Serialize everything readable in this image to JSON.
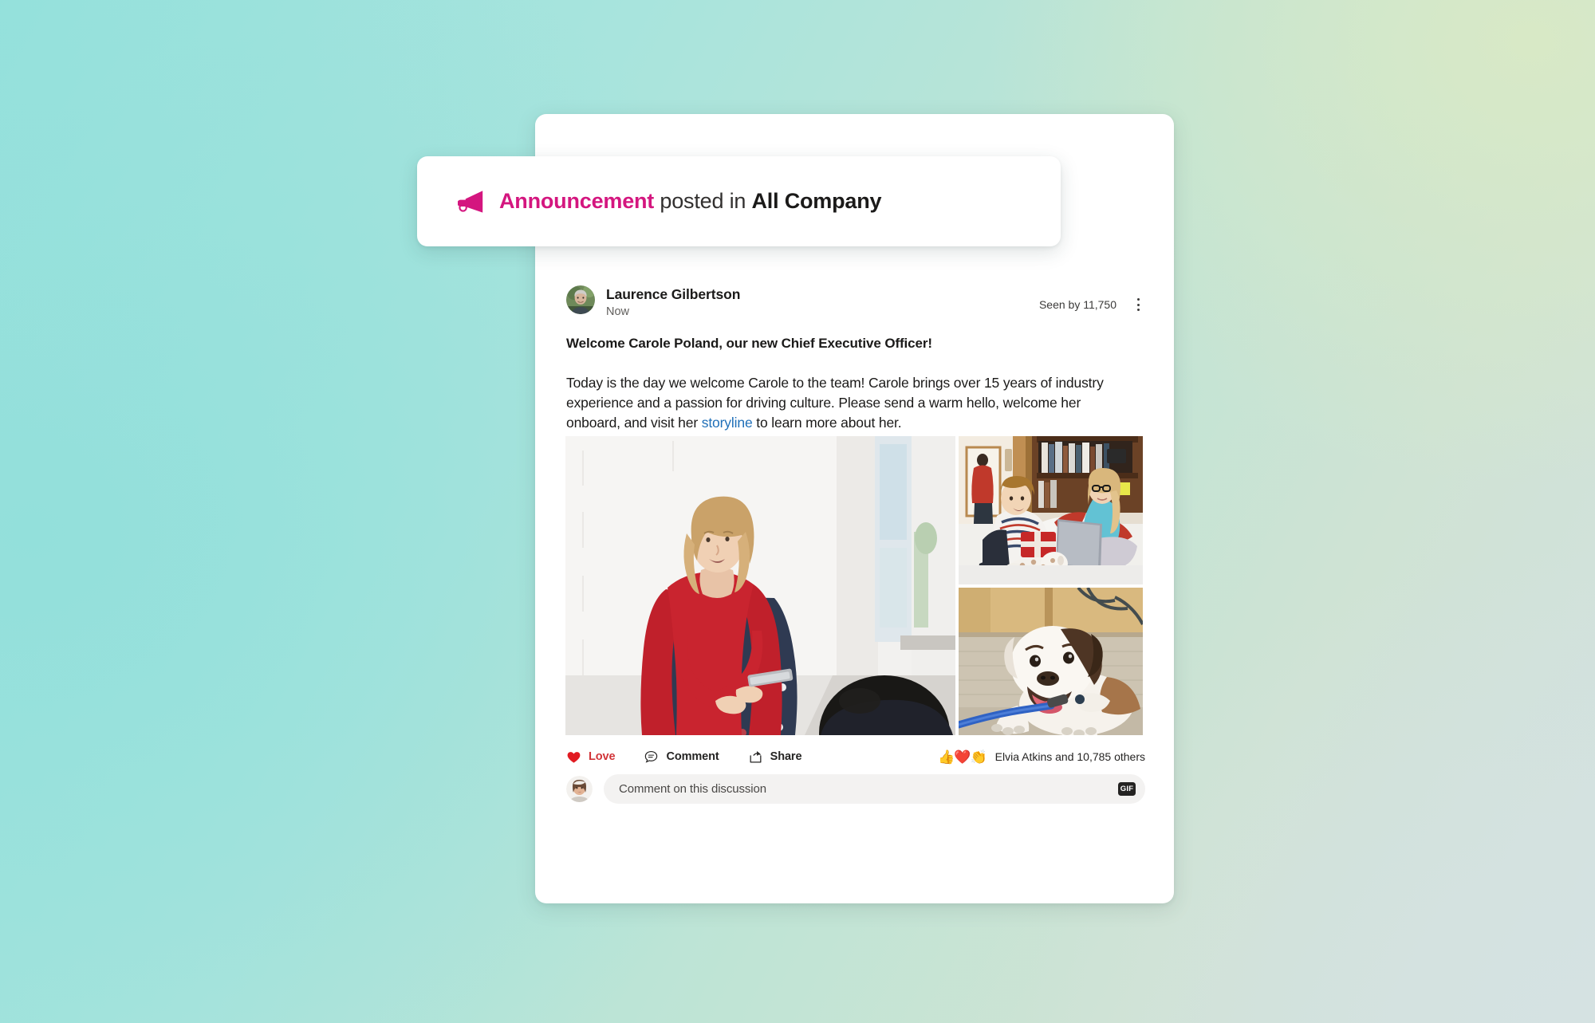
{
  "banner": {
    "icon": "megaphone-icon",
    "keyword": "Announcement",
    "middle": " posted in ",
    "group": "All Company",
    "accent_color": "#d4167f"
  },
  "post": {
    "author": "Laurence Gilbertson",
    "timestamp": "Now",
    "seen_by": "Seen by 11,750",
    "more_menu": "more-options",
    "title": "Welcome Carole Poland, our new Chief Executive Officer!",
    "body_part1": "Today is the day we welcome Carole to the team! Carole brings over 15 years of industry experience and a passion for driving culture. Please send a warm hello, welcome her onboard, and visit her ",
    "body_link": "storyline",
    "body_part2": " to learn more about her.",
    "link_color": "#1f6fb8"
  },
  "media": [
    {
      "name": "photo-woman-presenting",
      "alt": "Woman in red cardigan and polka dot dress speaking to a colleague in an office"
    },
    {
      "name": "photo-family-laptop",
      "alt": "Boy and woman looking at a laptop on a sofa at home"
    },
    {
      "name": "photo-bulldog",
      "alt": "Bulldog lying on an office carpet with a blue leash"
    }
  ],
  "actions": [
    {
      "name": "love",
      "icon": "heart-icon",
      "label": "Love",
      "color": "#d13438"
    },
    {
      "name": "comment",
      "icon": "comment-bubble-icon",
      "label": "Comment",
      "color": "#252423"
    },
    {
      "name": "share",
      "icon": "share-arrow-icon",
      "label": "Share",
      "color": "#252423"
    }
  ],
  "reactions": {
    "emojis": [
      "👍",
      "❤️",
      "👏"
    ],
    "summary": "Elvia Atkins and 10,785 others"
  },
  "comment_box": {
    "avatar": "current-user-avatar",
    "placeholder": "Comment on this discussion",
    "gif_label": "GIF"
  }
}
